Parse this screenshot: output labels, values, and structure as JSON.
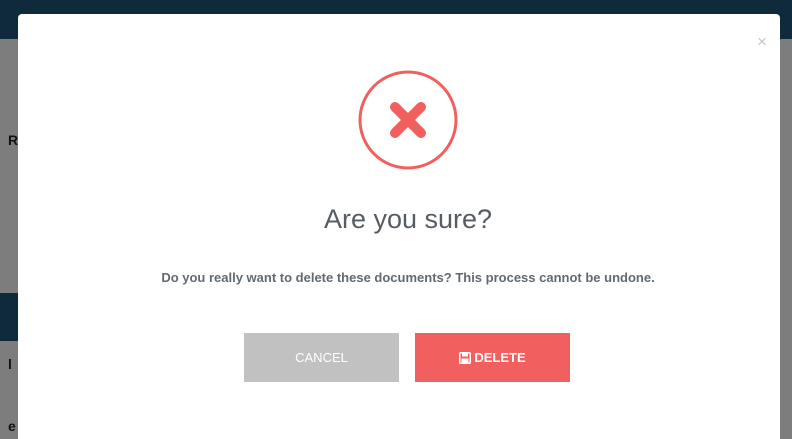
{
  "background": {
    "peek_texts": [
      "R",
      "l",
      "e"
    ]
  },
  "dialog": {
    "close_label": "×",
    "icon": "x-circle-icon",
    "title": "Are you sure?",
    "message": "Do you really want to delete these documents? This process cannot be undone.",
    "cancel_label": "CANCEL",
    "delete_label": "DELETE",
    "delete_icon": "save-icon"
  },
  "colors": {
    "accent": "#f25f5f",
    "cancel": "#c1c1c1",
    "header": "#0f2a3a",
    "overlay": "#7d7d7d"
  }
}
